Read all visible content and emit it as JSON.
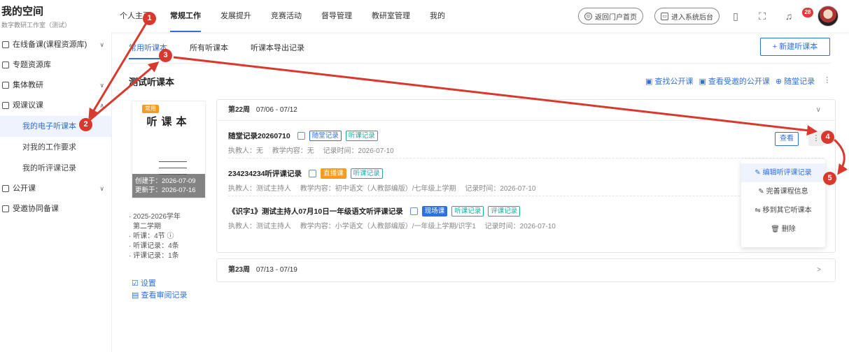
{
  "brand": {
    "title": "我的空间",
    "subtitle": "数字教研工作室（测试）"
  },
  "nav": {
    "items": [
      "个人主页",
      "常规工作",
      "发展提升",
      "竞赛活动",
      "督导管理",
      "教研室管理",
      "我的"
    ],
    "active": "常规工作"
  },
  "top_right": {
    "portal": "返回门户首页",
    "backend": "进入系统后台",
    "notifications": "28"
  },
  "sidebar": {
    "items": [
      {
        "label": "在线备课(课程资源库)",
        "chevron": "∨"
      },
      {
        "label": "专题资源库",
        "chevron": ""
      },
      {
        "label": "集体教研",
        "chevron": "∨"
      },
      {
        "label": "观课议课",
        "chevron": "∧"
      }
    ],
    "sub": [
      "我的电子听课本",
      "对我的工作要求",
      "我的听评课记录"
    ],
    "items2": [
      {
        "label": "公开课",
        "chevron": "∨"
      },
      {
        "label": "受邀协同备课",
        "chevron": ""
      }
    ]
  },
  "tabs": [
    "常用听课本",
    "所有听课本",
    "听课本导出记录"
  ],
  "new_button": "+ 新建听课本",
  "book": {
    "heading": "测试听课本",
    "tag": "常用",
    "cover_title": "听课本",
    "created": "创建于：2026-07-09",
    "updated": "更新于：2026-07-16",
    "meta": [
      "· 2025-2026学年",
      "  第二学期",
      "· 听课：4节 ⓘ",
      "· 听课记录：4条",
      "· 评课记录：1条"
    ],
    "links": [
      "☑ 设置",
      "▤ 查看审阅记录"
    ]
  },
  "actions": [
    "▣ 查找公开课",
    "▣ 查看受邀的公开课",
    "⊕ 随堂记录",
    "⋮"
  ],
  "weeks": [
    {
      "label": "第22周",
      "range": "07/06 - 07/12",
      "chevron": "∨",
      "records": [
        {
          "title": "随堂记录20260710",
          "tags": [
            {
              "t": "随堂记录",
              "c": "blue"
            },
            {
              "t": "听课记录",
              "c": "cyan"
            }
          ],
          "meta": "执教人：无　 教学内容：无　 记录时间：2026-07-10"
        },
        {
          "title": "234234234听评课记录",
          "tags": [
            {
              "t": "直播课",
              "c": "orange"
            },
            {
              "t": "听课记录",
              "c": "cyan"
            }
          ],
          "meta": "执教人：测试主持人　 教学内容：初中语文（人教部编版）/七年级上学期　 记录时间：2026-07-10"
        },
        {
          "title": "《识字1》测试主持人07月10日一年级语文听评课记录",
          "tags": [
            {
              "t": "现场课",
              "c": "solidblue"
            },
            {
              "t": "听课记录",
              "c": "cyan"
            },
            {
              "t": "评课记录",
              "c": "cyan"
            }
          ],
          "meta": "执教人：测试主持人　 教学内容：小学语文（人教部编版）/一年级上学期/识字1　 记录时间：2026-07-10"
        }
      ]
    },
    {
      "label": "第23周",
      "range": "07/13 - 07/19",
      "chevron": ">"
    }
  ],
  "view_button": "查看",
  "more_button": "⋮",
  "dropdown": [
    "✎ 编辑听评课记录",
    "✎ 完善课程信息",
    "⇋ 移到其它听课本",
    "🗑 删除"
  ],
  "annotations": [
    "1",
    "2",
    "3",
    "4",
    "5"
  ],
  "colors": {
    "accent": "#2f6fe4",
    "annotation": "#d9392c"
  }
}
